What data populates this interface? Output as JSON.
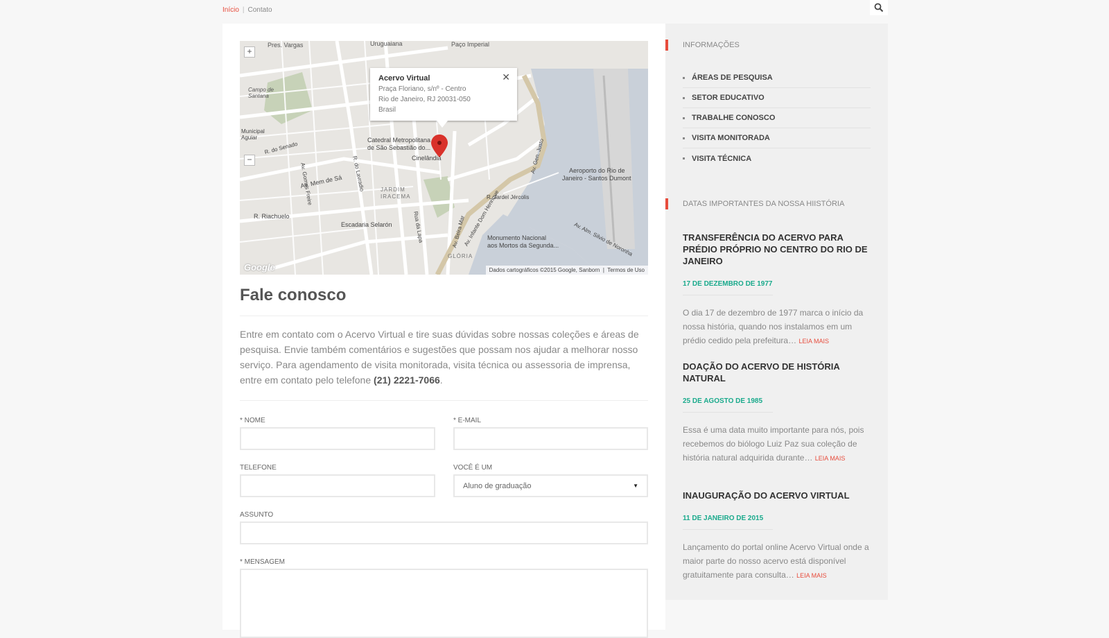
{
  "breadcrumb": {
    "home": "Início",
    "current": "Contato"
  },
  "map": {
    "popup": {
      "title": "Acervo Virtual",
      "line1": "Praça Floriano, s/nº - Centro",
      "line2": "Rio de Janeiro, RJ 20031-050",
      "line3": "Brasil"
    },
    "zoom_in": "+",
    "zoom_out": "−",
    "attribution": "Dados cartográficos ©2015 Google, Sanborn",
    "terms": "Termos de Uso",
    "logo": "Google",
    "labels": {
      "pres_vargas": "Pres. Vargas",
      "uruguaiana": "Uruguaiana",
      "paco": "Paço Imperial",
      "campo": "Campo de Santana",
      "catedral1": "Catedral Metropolitana",
      "catedral2": "de São Sebastião do...",
      "cinelandia": "Cinelândia",
      "aeroporto1": "Aeroporto do Rio de",
      "aeroporto2": "Janeiro - Santos Dumont",
      "escadaria": "Escadaria Selarón",
      "monumento1": "Monumento Nacional",
      "monumento2": "aos Mortos da Segunda...",
      "riachuelo": "R. Riachuelo",
      "lavradio": "R. do Lavradio",
      "gomes": "Av. Gomes Freire",
      "lapa": "Rua da Lapa",
      "beira_mar": "Av. Beira Mar",
      "jardim": "JARDIM IRACEMA",
      "municipal": "Municipal Aguiar",
      "mem_sa": "Av. Mem de Sá",
      "senado": "R. do Senado",
      "infante": "Av. Infante Dom Henrique",
      "gen_justo": "Av. Gen. Justo",
      "jardel": "R. Jardel Jércolis",
      "alm_silvio": "Av. Alm. Silvio de Noronha",
      "gloria": "GLÓRIA"
    }
  },
  "page": {
    "title": "Fale conosco",
    "intro": "Entre em contato com o Acervo Virtual e tire suas dúvidas sobre nossas coleções e áreas de pesquisa. Envie também comentários e sugestões que possam nos ajudar a melhorar nosso serviço. Para agendamento de visita monitorada, visita técnica ou assessoria de imprensa, entre em contato pelo telefone ",
    "phone": "(21) 2221-7066",
    "intro_end": "."
  },
  "form": {
    "nome_label": "* NOME",
    "email_label": "* E-MAIL",
    "telefone_label": "TELEFONE",
    "voce_label": "VOCÊ É UM",
    "voce_value": "Aluno de graduação",
    "assunto_label": "ASSUNTO",
    "mensagem_label": "* MENSAGEM"
  },
  "sidebar": {
    "info_title": "INFORMAÇÕES",
    "links": [
      "ÁREAS DE PESQUISA",
      "SETOR EDUCATIVO",
      "TRABALHE CONOSCO",
      "VISITA MONITORADA",
      "VISITA TÉCNICA"
    ],
    "dates_title": "DATAS IMPORTANTES DA NOSSA HIISTÓRIA",
    "posts": [
      {
        "title": "TRANSFERÊNCIA DO ACERVO PARA PRÉDIO PRÓPRIO NO CENTRO DO RIO DE JANEIRO",
        "date": "17 DE DEZEMBRO DE 1977",
        "body": "O dia 17 de dezembro de 1977 marca o início da nossa história, quando nos instalamos em um prédio cedido pela prefeitura…",
        "more": "LEIA MAIS"
      },
      {
        "title": "DOAÇÃO DO ACERVO DE HISTÓRIA NATURAL",
        "date": "25 DE AGOSTO DE 1985",
        "body": "Essa é uma data muito importante para nós, pois recebemos do biólogo Luiz Paz sua coleção de história natural adquirida durante…",
        "more": "LEIA MAIS"
      },
      {
        "title": "INAUGURAÇÃO DO ACERVO VIRTUAL",
        "date": "11 DE JANEIRO DE 2015",
        "body": "Lançamento do portal online Acervo Virtual onde a maior parte do nosso acervo está disponível gratuitamente para consulta…",
        "more": "LEIA MAIS"
      }
    ]
  },
  "colors": {
    "accent": "#e74c3c",
    "date": "#1aaa8c"
  },
  "icons": {
    "search": "search-icon",
    "marker": "map-marker-icon",
    "close": "close-icon"
  }
}
